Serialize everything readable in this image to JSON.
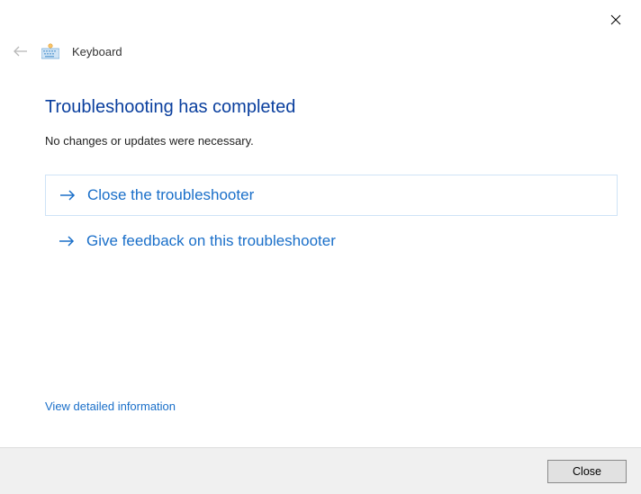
{
  "header": {
    "title": "Keyboard"
  },
  "main": {
    "heading": "Troubleshooting has completed",
    "subtext": "No changes or updates were necessary.",
    "option_close": "Close the troubleshooter",
    "option_feedback": "Give feedback on this troubleshooter",
    "detail_link": "View detailed information"
  },
  "footer": {
    "close_label": "Close"
  }
}
